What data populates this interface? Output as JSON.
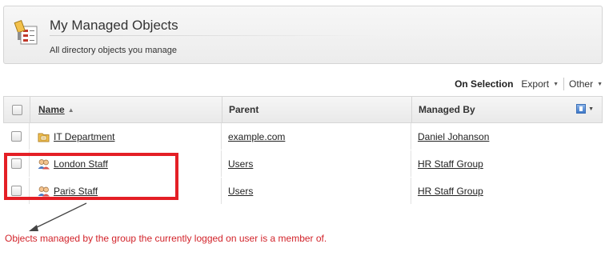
{
  "header": {
    "title": "My Managed Objects",
    "subtitle": "All directory objects you manage",
    "icon": "managed-objects-icon"
  },
  "toolbar": {
    "on_selection": "On Selection",
    "export": "Export",
    "other": "Other"
  },
  "table": {
    "columns": {
      "name": "Name",
      "parent": "Parent",
      "managed_by": "Managed By"
    },
    "sort": {
      "column": "Name",
      "direction": "ascending"
    },
    "rows": [
      {
        "name": "IT Department",
        "icon": "organizational-unit-icon",
        "parent": "example.com",
        "managed_by": "Daniel Johanson"
      },
      {
        "name": "London Staff",
        "icon": "group-icon",
        "parent": "Users",
        "managed_by": "HR Staff Group"
      },
      {
        "name": "Paris Staff",
        "icon": "group-icon",
        "parent": "Users",
        "managed_by": "HR Staff Group"
      }
    ]
  },
  "annotation": {
    "text": "Objects managed by the group the currently logged on user is a member of.",
    "color": "#d2232a"
  },
  "colors": {
    "annotation_box": "#e41f26"
  }
}
